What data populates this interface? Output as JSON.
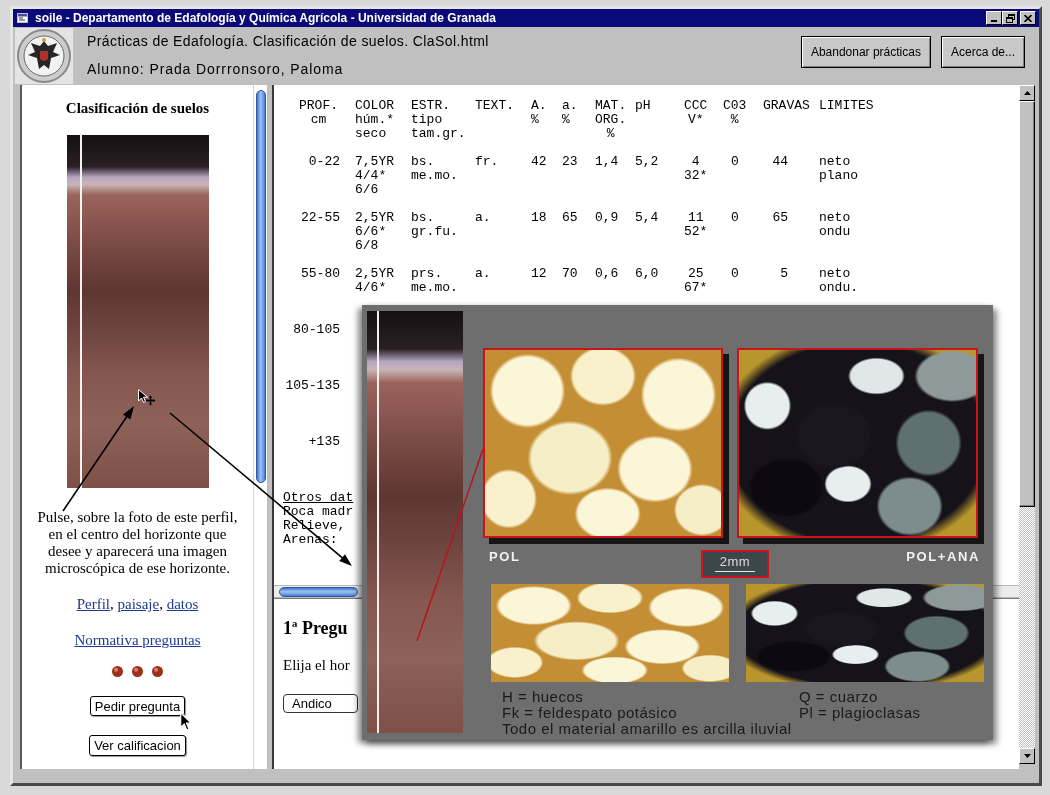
{
  "window": {
    "title": "soile - Departamento de Edafología y Química Agrícola - Universidad de Granada"
  },
  "header": {
    "title": "Prácticas de Edafología. Clasificación de suelos. ClaSol.html",
    "student": "Alumno: Prada Dorrronsoro, Paloma",
    "buttons": [
      "Abandonar prácticas",
      "Acerca de..."
    ]
  },
  "sidebar": {
    "title": "Clasificación de suelos",
    "instructions": [
      "Pulse, sobre la foto de este perfil,",
      "en el centro del horizonte que",
      "desee y aparecerá una imagen",
      "microscópica de ese horizonte."
    ],
    "links": [
      "Perfil",
      "paisaje",
      "datos"
    ],
    "link_separator": ", ",
    "rules_link": "Normativa preguntas",
    "buttons": [
      "Pedir pregunta",
      "Ver calificacion"
    ]
  },
  "table": {
    "columns": [
      {
        "lines": [
          "PROF.",
          "cm"
        ]
      },
      {
        "lines": [
          "COLOR",
          "húm.*",
          "seco"
        ]
      },
      {
        "lines": [
          "ESTR.",
          "tipo",
          "tam.gr."
        ]
      },
      {
        "lines": [
          "TEXT."
        ]
      },
      {
        "lines": [
          "A.",
          "%"
        ]
      },
      {
        "lines": [
          "a.",
          "%"
        ]
      },
      {
        "lines": [
          "MAT.",
          "ORG.",
          "%"
        ]
      },
      {
        "lines": [
          "pH"
        ]
      },
      {
        "lines": [
          "CCC",
          "V*"
        ]
      },
      {
        "lines": [
          "C03",
          "%"
        ]
      },
      {
        "lines": [
          "GRAVAS"
        ]
      },
      {
        "lines": [
          "LIMITES"
        ]
      }
    ],
    "rows": [
      {
        "cells": [
          [
            "0-22"
          ],
          [
            "7,5YR",
            "4/4*",
            "6/6"
          ],
          [
            "bs.",
            "me.mo."
          ],
          [
            "fr."
          ],
          [
            "42"
          ],
          [
            "23"
          ],
          [
            "1,4"
          ],
          [
            "5,2"
          ],
          [
            "4",
            "32*"
          ],
          [
            "0"
          ],
          [
            "44"
          ],
          [
            "neto",
            "plano"
          ]
        ]
      },
      {
        "cells": [
          [
            "22-55"
          ],
          [
            "2,5YR",
            "6/6*",
            "6/8"
          ],
          [
            "bs.",
            "gr.fu."
          ],
          [
            "a."
          ],
          [
            "18"
          ],
          [
            "65"
          ],
          [
            "0,9"
          ],
          [
            "5,4"
          ],
          [
            "11",
            "52*"
          ],
          [
            "0"
          ],
          [
            "65"
          ],
          [
            "neto",
            "ondu"
          ]
        ]
      },
      {
        "cells": [
          [
            "55-80"
          ],
          [
            "2,5YR",
            "4/6*"
          ],
          [
            "prs.",
            "me.mo."
          ],
          [
            "a."
          ],
          [
            "12"
          ],
          [
            "70"
          ],
          [
            "0,6"
          ],
          [
            "6,0"
          ],
          [
            "25",
            "67*"
          ],
          [
            "0"
          ],
          [
            "5"
          ],
          [
            "neto",
            "ondu."
          ]
        ]
      },
      {
        "cells": [
          [
            "80-105"
          ]
        ]
      },
      {
        "cells": [
          [
            "105-135"
          ]
        ]
      },
      {
        "cells": [
          [
            "+135"
          ]
        ]
      }
    ],
    "notes": {
      "heading": "Otros dat",
      "lines": [
        "Roca madr",
        "Relieve,",
        "Arenas:"
      ]
    }
  },
  "question": {
    "title": "1ª Pregu",
    "prompt": "Elija el hor",
    "answer": "Andico"
  },
  "popup": {
    "left_label": "POL",
    "scale": "2mm",
    "right_label": "POL+ANA",
    "legend": {
      "left": [
        "H = huecos",
        "Fk = feldespato potásico",
        "Todo el material amarillo es arcilla iluvial"
      ],
      "right": [
        "Q = cuarzo",
        "Pl = plagioclasas"
      ]
    }
  }
}
